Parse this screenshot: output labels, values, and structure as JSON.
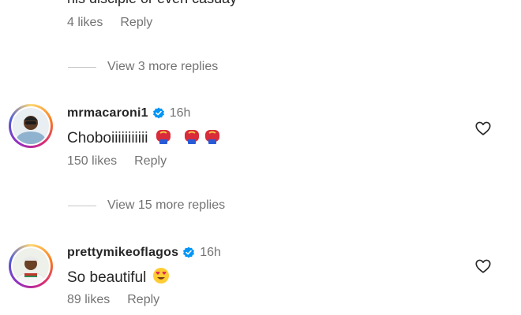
{
  "top_comment": {
    "text_partial": "his disciple or even casuay",
    "likes": "4 likes",
    "reply_label": "Reply"
  },
  "view_replies_1": "View 3 more replies",
  "comments": [
    {
      "username": "mrmacaroni1",
      "time": "16h",
      "text": "Choboiiiiiiiiiii",
      "emojis": "boxing-glove-emoji x3",
      "likes": "150 likes",
      "reply_label": "Reply",
      "view_replies": "View 15 more replies"
    },
    {
      "username": "prettymikeoflagos",
      "time": "16h",
      "text": "So beautiful",
      "emojis": "heart-eyes-emoji",
      "likes": "89 likes",
      "reply_label": "Reply"
    }
  ],
  "colors": {
    "text": "#262626",
    "secondary": "#737373",
    "verified": "#0095f6"
  }
}
